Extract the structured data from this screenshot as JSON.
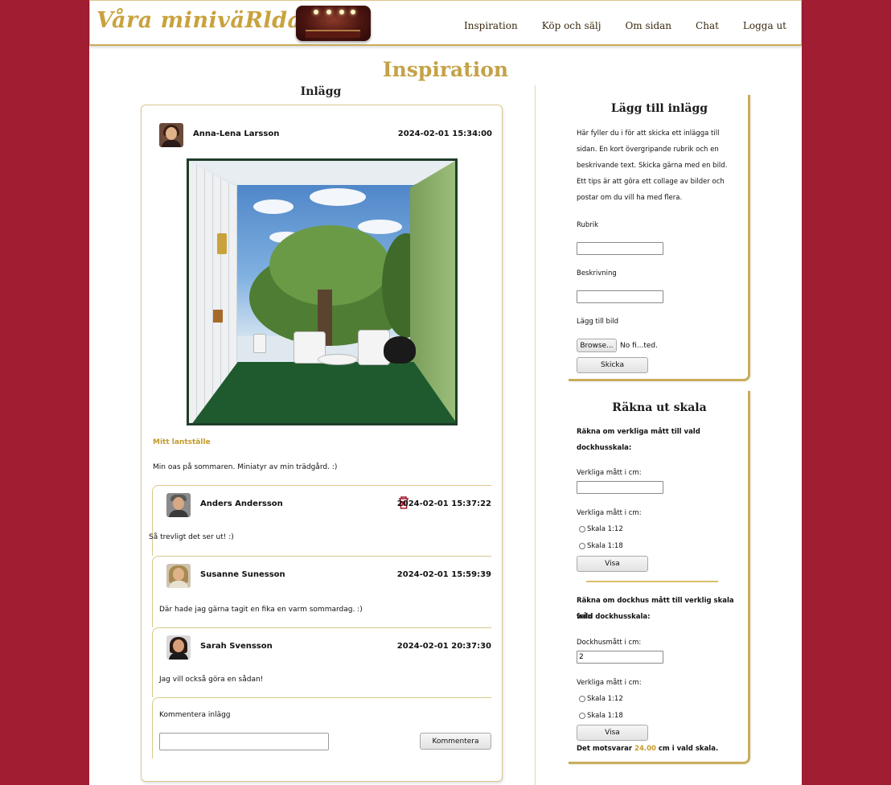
{
  "header": {
    "logo": "Våra miniväRldar",
    "nav": [
      "Inspiration",
      "Köp och sälj",
      "Om sidan",
      "Chat",
      "Logga ut"
    ]
  },
  "page_title": "Inspiration",
  "posts_section_title": "Inlägg",
  "post": {
    "author": "Anna-Lena Larsson",
    "date": "2024-02-01 15:34:00",
    "title": "Mitt lantställe",
    "text": "Min oas på sommaren. Miniatyr av min trädgård. :)"
  },
  "comments": [
    {
      "author": "Anders Andersson",
      "date": "2024-02-01 15:37:22",
      "text": "Så trevligt det ser ut! :)"
    },
    {
      "author": "Susanne Sunesson",
      "date": "2024-02-01 15:59:39",
      "text": "Där hade jag gärna tagit en fika en varm sommardag. :)"
    },
    {
      "author": "Sarah Svensson",
      "date": "2024-02-01 20:37:30",
      "text": "Jag vill också göra en sådan!"
    }
  ],
  "comment_form": {
    "label": "Kommentera inlägg",
    "button": "Kommentera"
  },
  "add_post": {
    "title": "Lägg till inlägg",
    "intro_lines": [
      "Här fyller du i för att skicka ett inlägga till",
      "sidan. En kort övergripande rubrik och en",
      "beskrivande text. Skicka gärna med en bild.",
      "Ett tips är att göra ett collage av bilder och",
      "postar om du vill ha med flera."
    ],
    "rubrik_label": "Rubrik",
    "beskrivning_label": "Beskrivning",
    "image_label": "Lägg till bild",
    "browse_button": "Browse...",
    "file_status": "No fi...ted.",
    "submit_button": "Skicka"
  },
  "scale": {
    "title": "Räkna ut skala",
    "section1_heading": [
      "Räkna om verkliga mått till vald",
      "dockhusskala:"
    ],
    "real_label": "Verkliga mått i cm:",
    "scale_label": "Verkliga mått i cm:",
    "options": [
      "Skala 1:12",
      "Skala 1:18"
    ],
    "show_button": "Visa",
    "section2_heading": [
      "Räkna om dockhus mått till verklig skala från",
      "vald dockhusskala:"
    ],
    "doll_label": "Dockhusmått i cm:",
    "doll_value": "2",
    "scale_label2": "Verkliga mått i cm:",
    "options2": [
      "Skala 1:12",
      "Skala 1:18"
    ],
    "show_button2": "Visa",
    "result_prefix": "Det motsvarar",
    "result_value": "24.00",
    "result_suffix": "cm i vald skala."
  }
}
